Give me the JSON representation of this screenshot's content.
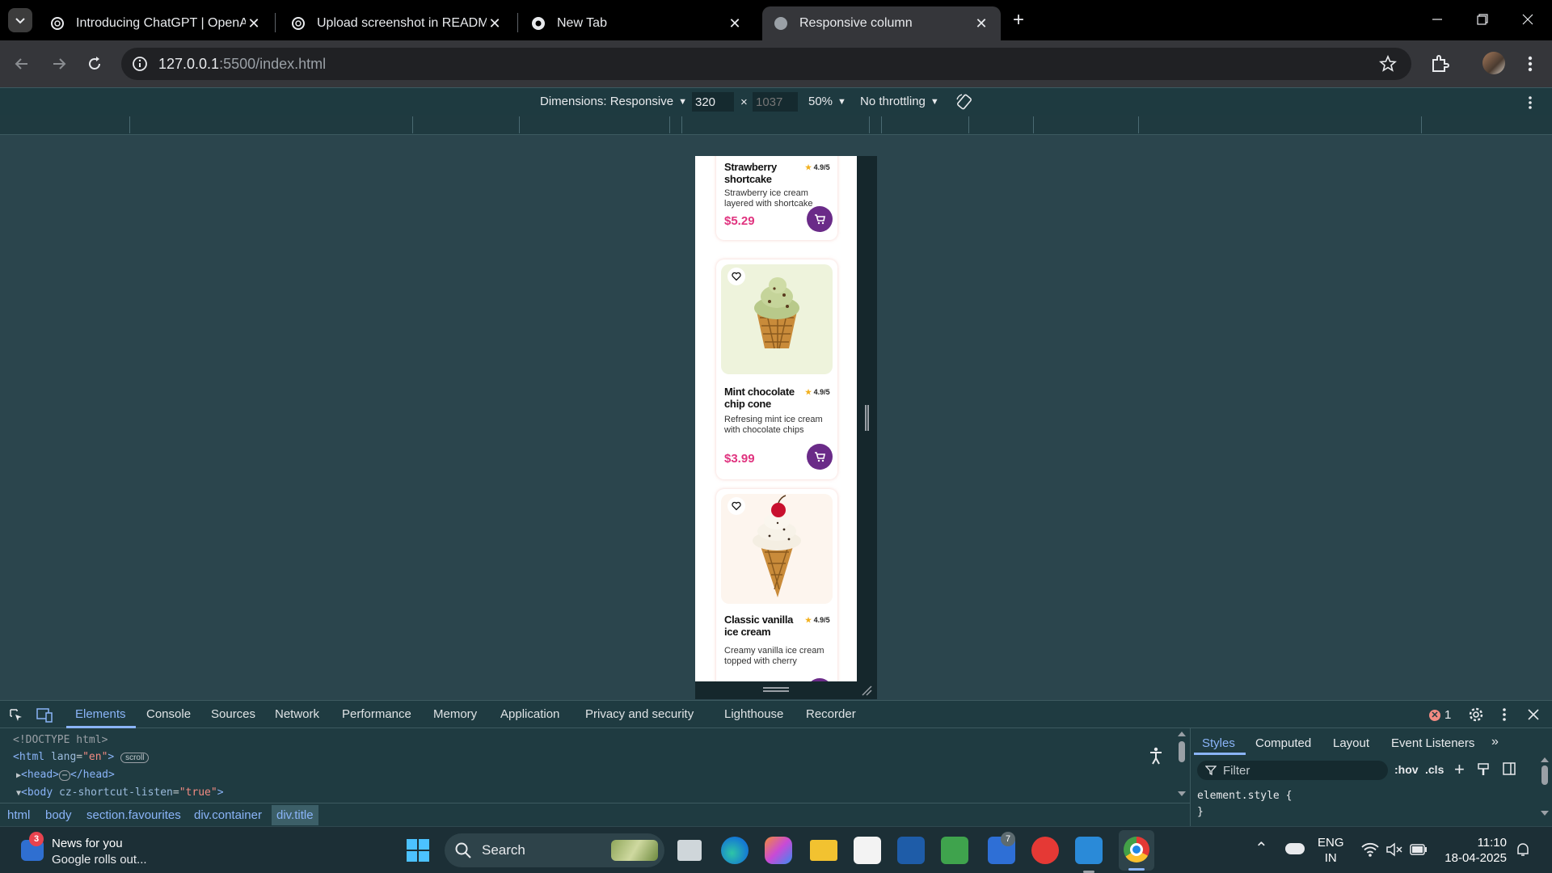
{
  "browser": {
    "tabs": [
      {
        "title": "Introducing ChatGPT | OpenAI",
        "active": false
      },
      {
        "title": "Upload screenshot in README",
        "active": false
      },
      {
        "title": "New Tab",
        "active": false
      },
      {
        "title": "Responsive column",
        "active": true
      }
    ],
    "url_host": "127.0.0.1",
    "url_rest": ":5500/index.html"
  },
  "device_toolbar": {
    "dimensions_label": "Dimensions: Responsive",
    "width": "320",
    "height_placeholder": "1037",
    "times": "×",
    "zoom": "50%",
    "throttling": "No throttling"
  },
  "page": {
    "products": [
      {
        "name": "Strawberry shortcake",
        "rating": "4.9/5",
        "description": "Strawberry ice cream layered with shortcake",
        "price": "$5.29"
      },
      {
        "name": "Mint chocolate chip cone",
        "rating": "4.9/5",
        "description": "Refresing mint ice cream with chocolate chips",
        "price": "$3.99"
      },
      {
        "name": "Classic vanilla ice cream",
        "rating": "4.9/5",
        "description": "Creamy vanilla ice cream topped with cherry",
        "price": ""
      }
    ]
  },
  "devtools": {
    "tabs": [
      "Elements",
      "Console",
      "Sources",
      "Network",
      "Performance",
      "Memory",
      "Application",
      "Privacy and security",
      "Lighthouse",
      "Recorder"
    ],
    "error_count": "1",
    "dom_lines": {
      "doctype": "<!DOCTYPE html>",
      "html_open": "<html",
      "html_attr": "lang",
      "html_val": "\"en\"",
      "html_close": ">",
      "scroll_badge": "scroll",
      "head": "<head>",
      "head_close": "</head>",
      "body_open": "<body",
      "body_attr": "cz-shortcut-listen",
      "body_val": "\"true\"",
      "body_close": ">"
    },
    "breadcrumbs": [
      "html",
      "body",
      "section.favourites",
      "div.container",
      "div.title"
    ],
    "styles_tabs": [
      "Styles",
      "Computed",
      "Layout",
      "Event Listeners"
    ],
    "filter_placeholder": "Filter",
    "hov": ":hov",
    "cls": ".cls",
    "element_style": "element.style {",
    "close_brace": "}"
  },
  "taskbar": {
    "news_title": "News for you",
    "news_sub": "Google rolls out...",
    "news_badge": "3",
    "search_label": "Search",
    "store_badge": "7",
    "lang_top": "ENG",
    "lang_bottom": "IN",
    "time": "11:10",
    "date": "18-04-2025"
  },
  "colors": {
    "accent_pink": "#e0337f",
    "accent_purple": "#6a2b88",
    "devtools_bg": "#1f3b41"
  }
}
